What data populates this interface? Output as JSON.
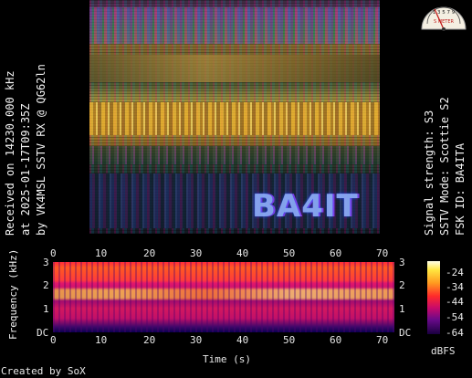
{
  "left_caption": {
    "line1": "Received on  14230.000 kHz",
    "line2": "at 2025-01-17T09:35Z",
    "line3": "by VK4MSL SSTV RX @ QG62ln"
  },
  "right_caption": {
    "line1": "Signal strength: S3",
    "line2": "SSTV Mode: Scottie S2",
    "line3": "FSK ID: BA4ITA"
  },
  "image": {
    "callsign_overlay": "BA4IT"
  },
  "s_meter": {
    "scale_numbers": "1 3 5 7 9",
    "label": "S METER",
    "level": "S3"
  },
  "spectrogram": {
    "x_ticks": [
      "0",
      "10",
      "20",
      "30",
      "40",
      "50",
      "60",
      "70"
    ],
    "y_ticks_left": [
      "3",
      "2",
      "1",
      "DC"
    ],
    "y_ticks_right": [
      "3",
      "2",
      "1",
      "DC"
    ],
    "xlabel": "Time (s)",
    "ylabel": "Frequency (kHz)"
  },
  "colorbar": {
    "ticks": [
      "-24",
      "-34",
      "-44",
      "-54",
      "-64"
    ],
    "unit": "dBFS"
  },
  "footer": {
    "credit": "Created by SoX"
  }
}
